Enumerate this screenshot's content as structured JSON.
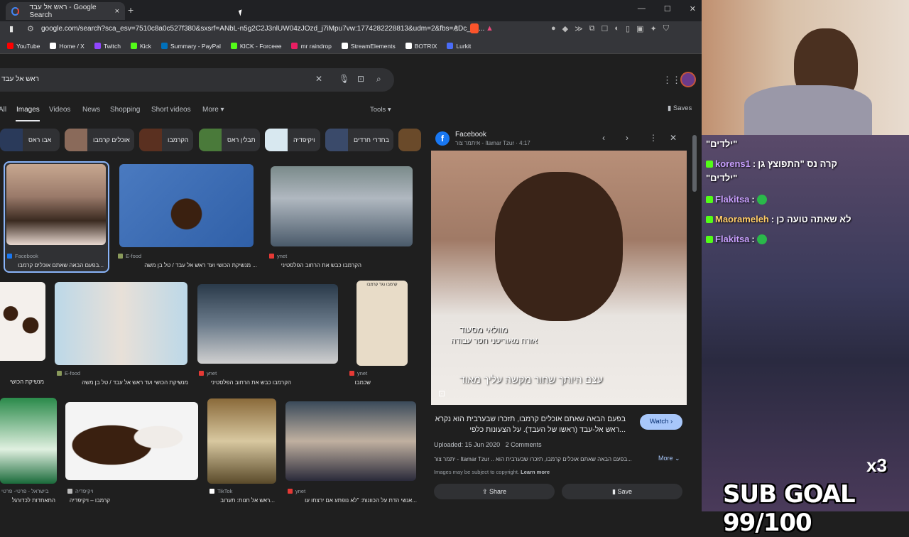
{
  "browser": {
    "tab_title": "ראש אל עבד - Google Search",
    "tab_close": "×",
    "new_tab": "+",
    "url": "google.com/search?sca_esv=7510c8a0c527f380&sxsrf=ANbL-n5g2C2J3nlUW04zJOzd_j7iMpu7vw:1774282228813&udm=2&fbs=ADc_l-a...",
    "win_min": "—",
    "win_max": "☐",
    "win_close": "✕",
    "bookmarks": [
      {
        "label": "YouTube",
        "color": "#ff0000"
      },
      {
        "label": "Home / X",
        "color": "#ffffff"
      },
      {
        "label": "Twitch",
        "color": "#9146ff"
      },
      {
        "label": "Kick",
        "color": "#53fc18"
      },
      {
        "label": "Summary - PayPal",
        "color": "#0070ba"
      },
      {
        "label": "KICK - Forceee",
        "color": "#53fc18"
      },
      {
        "label": "mr raindrop",
        "color": "#e91e63"
      },
      {
        "label": "StreamElements",
        "color": "#ffffff"
      },
      {
        "label": "BOTRIX",
        "color": "#ffffff"
      },
      {
        "label": "Lurkit",
        "color": "#4a6cf7"
      }
    ]
  },
  "google": {
    "query": "ראש אל עבד",
    "nav": {
      "all": "All",
      "images": "Images",
      "videos": "Videos",
      "news": "News",
      "shopping": "Shopping",
      "short_videos": "Short videos",
      "more": "More ▾"
    },
    "tools": "Tools ▾",
    "saves": "Saves",
    "chips": [
      "אבו ראס",
      "אוכלים קרמבו",
      "הקרמבו",
      "תבלין ראס",
      "ויקיפדיה",
      "בחדרי חרדים"
    ],
    "results": [
      {
        "source": "Facebook",
        "caption": "בפעם הבאה שאתם אוכלים קרמבו...",
        "src_color": "#1877f2"
      },
      {
        "source": "E-food",
        "caption": "מנשיקת הכושי ועד ראש אל עבד / טל בן משה ...",
        "src_color": "#8a9a5b"
      },
      {
        "source": "ynet",
        "caption": "הקרמבו כבש את הרחוב הפלסטיני",
        "src_color": "#e53935"
      },
      {
        "source": "",
        "caption": "מנשיקת הכושי",
        "src_color": "#888888"
      },
      {
        "source": "E-food",
        "caption": "מנשיקת הכושי ועד ראש אל עבד / טל בן משה",
        "src_color": "#8a9a5b"
      },
      {
        "source": "ynet",
        "caption": "הקרמבו כבש את הרחוב הפלסטיני",
        "src_color": "#e53935"
      },
      {
        "source": "ynet",
        "caption": "שכמבו",
        "src_color": "#e53935"
      },
      {
        "source": "בישראל - פרטי- פרטי",
        "caption": "התאחדות לכדורגל",
        "src_color": "#888888"
      },
      {
        "source": "ויקיפדיה",
        "caption": "קרמבו – ויקיפדיה",
        "src_color": "#bbbbbb"
      },
      {
        "source": "TikTok",
        "caption": "ראש אל חנות: תערוב...",
        "src_color": "#ffffff"
      },
      {
        "source": "ynet",
        "caption": "אנשי הדת על הכוונות: \"לא נופתע אם ירצחו עו...",
        "src_color": "#e53935"
      }
    ],
    "poster_text": "קרמבו נגד קרמבו",
    "panel": {
      "site": "Facebook",
      "author": "איתמר צור - Itamar Tzur · 4:17",
      "video_caption_1": "מוולאי מסעוד",
      "video_caption_2": "אזרח מאוריטני חסר עבודה",
      "video_subtitle": "עצם היותך שחור מקשה עליך מאוד",
      "title": "בפעם הבאה שאתם אוכלים קרמבו, תזכרו שבערבית הוא נקרא ראש אל-עבד (ראשו של העבד). על הצעונות כלפי...",
      "watch": "Watch ›",
      "uploaded": "Uploaded: 15 Jun 2020",
      "comments": "2 Comments",
      "desc": "יתמר צור - Itamar Tzur .. בפעם הבאה שאתם אוכלים קרמבו, תזכרו שבערבית הוא...",
      "more": "More ⌄",
      "copyright": "Images may be subject to copyright.",
      "learn_more": "Learn more",
      "share": "Share",
      "save": "Save"
    }
  },
  "stream": {
    "chat": [
      {
        "user": "",
        "text": "\"ילדים\"",
        "color": "#ffffff"
      },
      {
        "user": "korens1",
        "text": "קרה נס \"התפוצץ גן",
        "color": "#c9a0ff"
      },
      {
        "user": "",
        "text": "\"ילדים\"",
        "color": "#ffffff"
      },
      {
        "user": "Flakitsa",
        "text": "",
        "color": "#c9a0ff"
      },
      {
        "user": "Maorameleh",
        "text": "לא שאתה טועה כן",
        "color": "#ffcc66"
      },
      {
        "user": "Flakitsa",
        "text": "",
        "color": "#c9a0ff"
      }
    ],
    "chat_sep": ":",
    "multiplier": "x3",
    "sub_goal": "SUB GOAL 99/100"
  }
}
